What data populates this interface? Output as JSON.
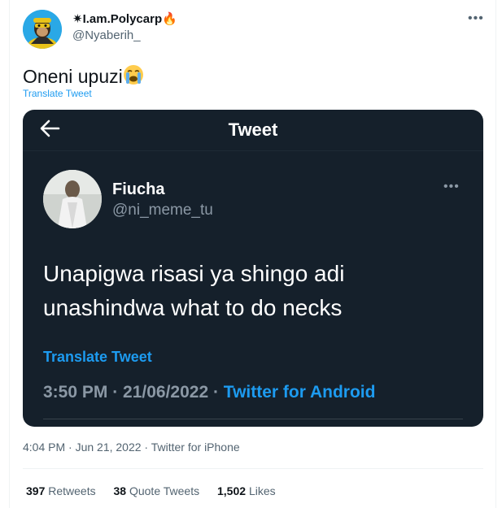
{
  "author": {
    "display_name": "✷I.am.Polycarp🔥",
    "handle": "@Nyaberih_"
  },
  "tweet": {
    "text": "Oneni upuzi",
    "translate_label": "Translate Tweet",
    "more_icon": "more-horizontal-icon"
  },
  "embedded": {
    "header_title": "Tweet",
    "back_icon": "arrow-left-icon",
    "author_name": "Fiucha",
    "author_handle": "@ni_meme_tu",
    "text": "Unapigwa risasi ya shingo adi unashindwa what to do necks",
    "translate_label": "Translate Tweet",
    "timestamp": "3:50 PM · 21/06/2022 · ",
    "source": "Twitter for Android",
    "colors": {
      "background": "#15202b",
      "accent": "#1d9bf0",
      "muted": "#8b98a5"
    }
  },
  "meta": {
    "timestamp": "4:04 PM · Jun 21, 2022 · Twitter for iPhone"
  },
  "stats": {
    "retweets_count": "397",
    "retweets_label": "Retweets",
    "quotes_count": "38",
    "quotes_label": "Quote Tweets",
    "likes_count": "1,502",
    "likes_label": "Likes"
  },
  "colors": {
    "accent": "#1d9bf0",
    "text": "#0f1419",
    "secondary": "#536471"
  }
}
